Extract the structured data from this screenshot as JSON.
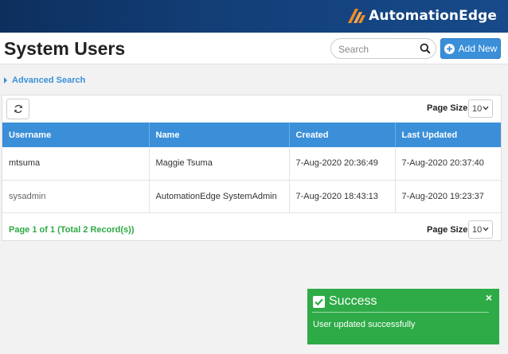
{
  "brand": {
    "logo_text": "AutomationEdge"
  },
  "header": {
    "title": "System Users",
    "search_placeholder": "Search",
    "add_new_label": "Add New"
  },
  "advanced_search_label": "Advanced Search",
  "toolbar": {
    "page_size_label": "Page Size",
    "page_size_value": "10"
  },
  "table": {
    "columns": [
      "Username",
      "Name",
      "Created",
      "Last Updated"
    ],
    "rows": [
      [
        "mtsuma",
        "Maggie Tsuma",
        "7-Aug-2020 20:36:49",
        "7-Aug-2020 20:37:40"
      ],
      [
        "sysadmin",
        "AutomationEdge SystemAdmin",
        "7-Aug-2020 18:43:13",
        "7-Aug-2020 19:23:37"
      ]
    ]
  },
  "footer": {
    "page_info": "Page 1 of 1 (Total 2 Record(s))",
    "page_size_label": "Page Size",
    "page_size_value": "10"
  },
  "toast": {
    "title": "Success",
    "message": "User updated successfully",
    "close_glyph": "×"
  },
  "colors": {
    "accent": "#3a8fd8",
    "topbar": "#133f78",
    "success": "#2eab47",
    "logo_orange": "#f08a24"
  },
  "icons": {
    "search": "search-icon",
    "add": "plus-circle-icon",
    "refresh": "refresh-icon",
    "check": "check-square-icon",
    "close": "close-icon",
    "caret": "caret-right-icon",
    "dropdown": "chevron-down-icon"
  }
}
